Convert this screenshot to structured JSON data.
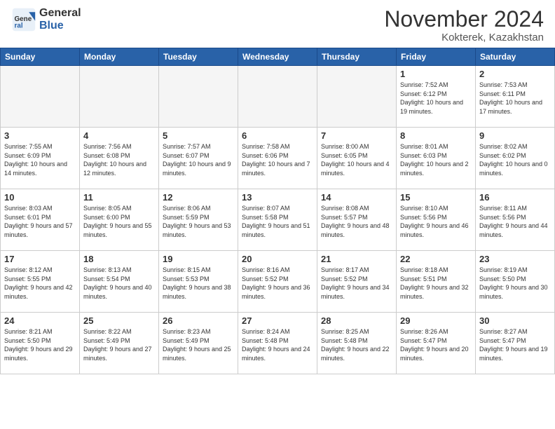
{
  "header": {
    "logo_general": "General",
    "logo_blue": "Blue",
    "month_title": "November 2024",
    "location": "Kokterek, Kazakhstan"
  },
  "weekdays": [
    "Sunday",
    "Monday",
    "Tuesday",
    "Wednesday",
    "Thursday",
    "Friday",
    "Saturday"
  ],
  "weeks": [
    [
      {
        "day": "",
        "info": ""
      },
      {
        "day": "",
        "info": ""
      },
      {
        "day": "",
        "info": ""
      },
      {
        "day": "",
        "info": ""
      },
      {
        "day": "",
        "info": ""
      },
      {
        "day": "1",
        "info": "Sunrise: 7:52 AM\nSunset: 6:12 PM\nDaylight: 10 hours and 19 minutes."
      },
      {
        "day": "2",
        "info": "Sunrise: 7:53 AM\nSunset: 6:11 PM\nDaylight: 10 hours and 17 minutes."
      }
    ],
    [
      {
        "day": "3",
        "info": "Sunrise: 7:55 AM\nSunset: 6:09 PM\nDaylight: 10 hours and 14 minutes."
      },
      {
        "day": "4",
        "info": "Sunrise: 7:56 AM\nSunset: 6:08 PM\nDaylight: 10 hours and 12 minutes."
      },
      {
        "day": "5",
        "info": "Sunrise: 7:57 AM\nSunset: 6:07 PM\nDaylight: 10 hours and 9 minutes."
      },
      {
        "day": "6",
        "info": "Sunrise: 7:58 AM\nSunset: 6:06 PM\nDaylight: 10 hours and 7 minutes."
      },
      {
        "day": "7",
        "info": "Sunrise: 8:00 AM\nSunset: 6:05 PM\nDaylight: 10 hours and 4 minutes."
      },
      {
        "day": "8",
        "info": "Sunrise: 8:01 AM\nSunset: 6:03 PM\nDaylight: 10 hours and 2 minutes."
      },
      {
        "day": "9",
        "info": "Sunrise: 8:02 AM\nSunset: 6:02 PM\nDaylight: 10 hours and 0 minutes."
      }
    ],
    [
      {
        "day": "10",
        "info": "Sunrise: 8:03 AM\nSunset: 6:01 PM\nDaylight: 9 hours and 57 minutes."
      },
      {
        "day": "11",
        "info": "Sunrise: 8:05 AM\nSunset: 6:00 PM\nDaylight: 9 hours and 55 minutes."
      },
      {
        "day": "12",
        "info": "Sunrise: 8:06 AM\nSunset: 5:59 PM\nDaylight: 9 hours and 53 minutes."
      },
      {
        "day": "13",
        "info": "Sunrise: 8:07 AM\nSunset: 5:58 PM\nDaylight: 9 hours and 51 minutes."
      },
      {
        "day": "14",
        "info": "Sunrise: 8:08 AM\nSunset: 5:57 PM\nDaylight: 9 hours and 48 minutes."
      },
      {
        "day": "15",
        "info": "Sunrise: 8:10 AM\nSunset: 5:56 PM\nDaylight: 9 hours and 46 minutes."
      },
      {
        "day": "16",
        "info": "Sunrise: 8:11 AM\nSunset: 5:56 PM\nDaylight: 9 hours and 44 minutes."
      }
    ],
    [
      {
        "day": "17",
        "info": "Sunrise: 8:12 AM\nSunset: 5:55 PM\nDaylight: 9 hours and 42 minutes."
      },
      {
        "day": "18",
        "info": "Sunrise: 8:13 AM\nSunset: 5:54 PM\nDaylight: 9 hours and 40 minutes."
      },
      {
        "day": "19",
        "info": "Sunrise: 8:15 AM\nSunset: 5:53 PM\nDaylight: 9 hours and 38 minutes."
      },
      {
        "day": "20",
        "info": "Sunrise: 8:16 AM\nSunset: 5:52 PM\nDaylight: 9 hours and 36 minutes."
      },
      {
        "day": "21",
        "info": "Sunrise: 8:17 AM\nSunset: 5:52 PM\nDaylight: 9 hours and 34 minutes."
      },
      {
        "day": "22",
        "info": "Sunrise: 8:18 AM\nSunset: 5:51 PM\nDaylight: 9 hours and 32 minutes."
      },
      {
        "day": "23",
        "info": "Sunrise: 8:19 AM\nSunset: 5:50 PM\nDaylight: 9 hours and 30 minutes."
      }
    ],
    [
      {
        "day": "24",
        "info": "Sunrise: 8:21 AM\nSunset: 5:50 PM\nDaylight: 9 hours and 29 minutes."
      },
      {
        "day": "25",
        "info": "Sunrise: 8:22 AM\nSunset: 5:49 PM\nDaylight: 9 hours and 27 minutes."
      },
      {
        "day": "26",
        "info": "Sunrise: 8:23 AM\nSunset: 5:49 PM\nDaylight: 9 hours and 25 minutes."
      },
      {
        "day": "27",
        "info": "Sunrise: 8:24 AM\nSunset: 5:48 PM\nDaylight: 9 hours and 24 minutes."
      },
      {
        "day": "28",
        "info": "Sunrise: 8:25 AM\nSunset: 5:48 PM\nDaylight: 9 hours and 22 minutes."
      },
      {
        "day": "29",
        "info": "Sunrise: 8:26 AM\nSunset: 5:47 PM\nDaylight: 9 hours and 20 minutes."
      },
      {
        "day": "30",
        "info": "Sunrise: 8:27 AM\nSunset: 5:47 PM\nDaylight: 9 hours and 19 minutes."
      }
    ]
  ]
}
